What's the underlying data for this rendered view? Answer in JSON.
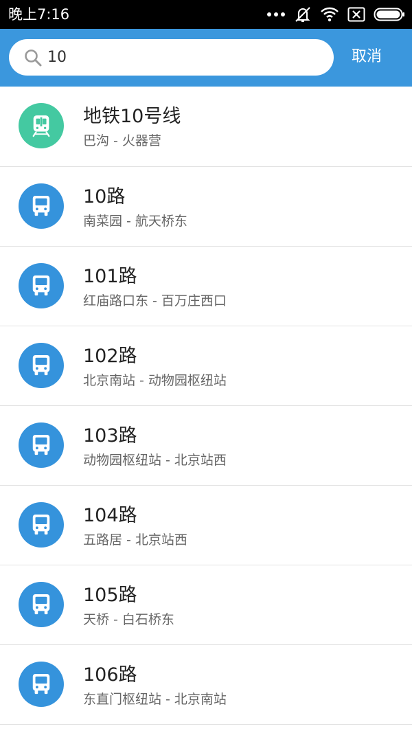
{
  "status_bar": {
    "time": "晚上7:16",
    "icons": [
      "more-dots-icon",
      "mute-icon",
      "wifi-icon",
      "no-sim-icon",
      "battery-icon"
    ]
  },
  "search": {
    "value": "10",
    "cancel_label": "取消"
  },
  "results": [
    {
      "type": "subway",
      "icon": "subway-icon",
      "name": "地铁10号线",
      "stops": "巴沟 - 火器营"
    },
    {
      "type": "bus",
      "icon": "bus-icon",
      "name": "10路",
      "stops": "南菜园 - 航天桥东"
    },
    {
      "type": "bus",
      "icon": "bus-icon",
      "name": "101路",
      "stops": "红庙路口东 - 百万庄西口"
    },
    {
      "type": "bus",
      "icon": "bus-icon",
      "name": "102路",
      "stops": "北京南站 - 动物园枢纽站"
    },
    {
      "type": "bus",
      "icon": "bus-icon",
      "name": "103路",
      "stops": "动物园枢纽站 - 北京站西"
    },
    {
      "type": "bus",
      "icon": "bus-icon",
      "name": "104路",
      "stops": "五路居 - 北京站西"
    },
    {
      "type": "bus",
      "icon": "bus-icon",
      "name": "105路",
      "stops": "天桥 - 白石桥东"
    },
    {
      "type": "bus",
      "icon": "bus-icon",
      "name": "106路",
      "stops": "东直门枢纽站 - 北京南站"
    }
  ],
  "colors": {
    "header": "#3b97dd",
    "bus_icon_bg": "#3593dc",
    "subway_icon_bg": "#44c9a1"
  }
}
